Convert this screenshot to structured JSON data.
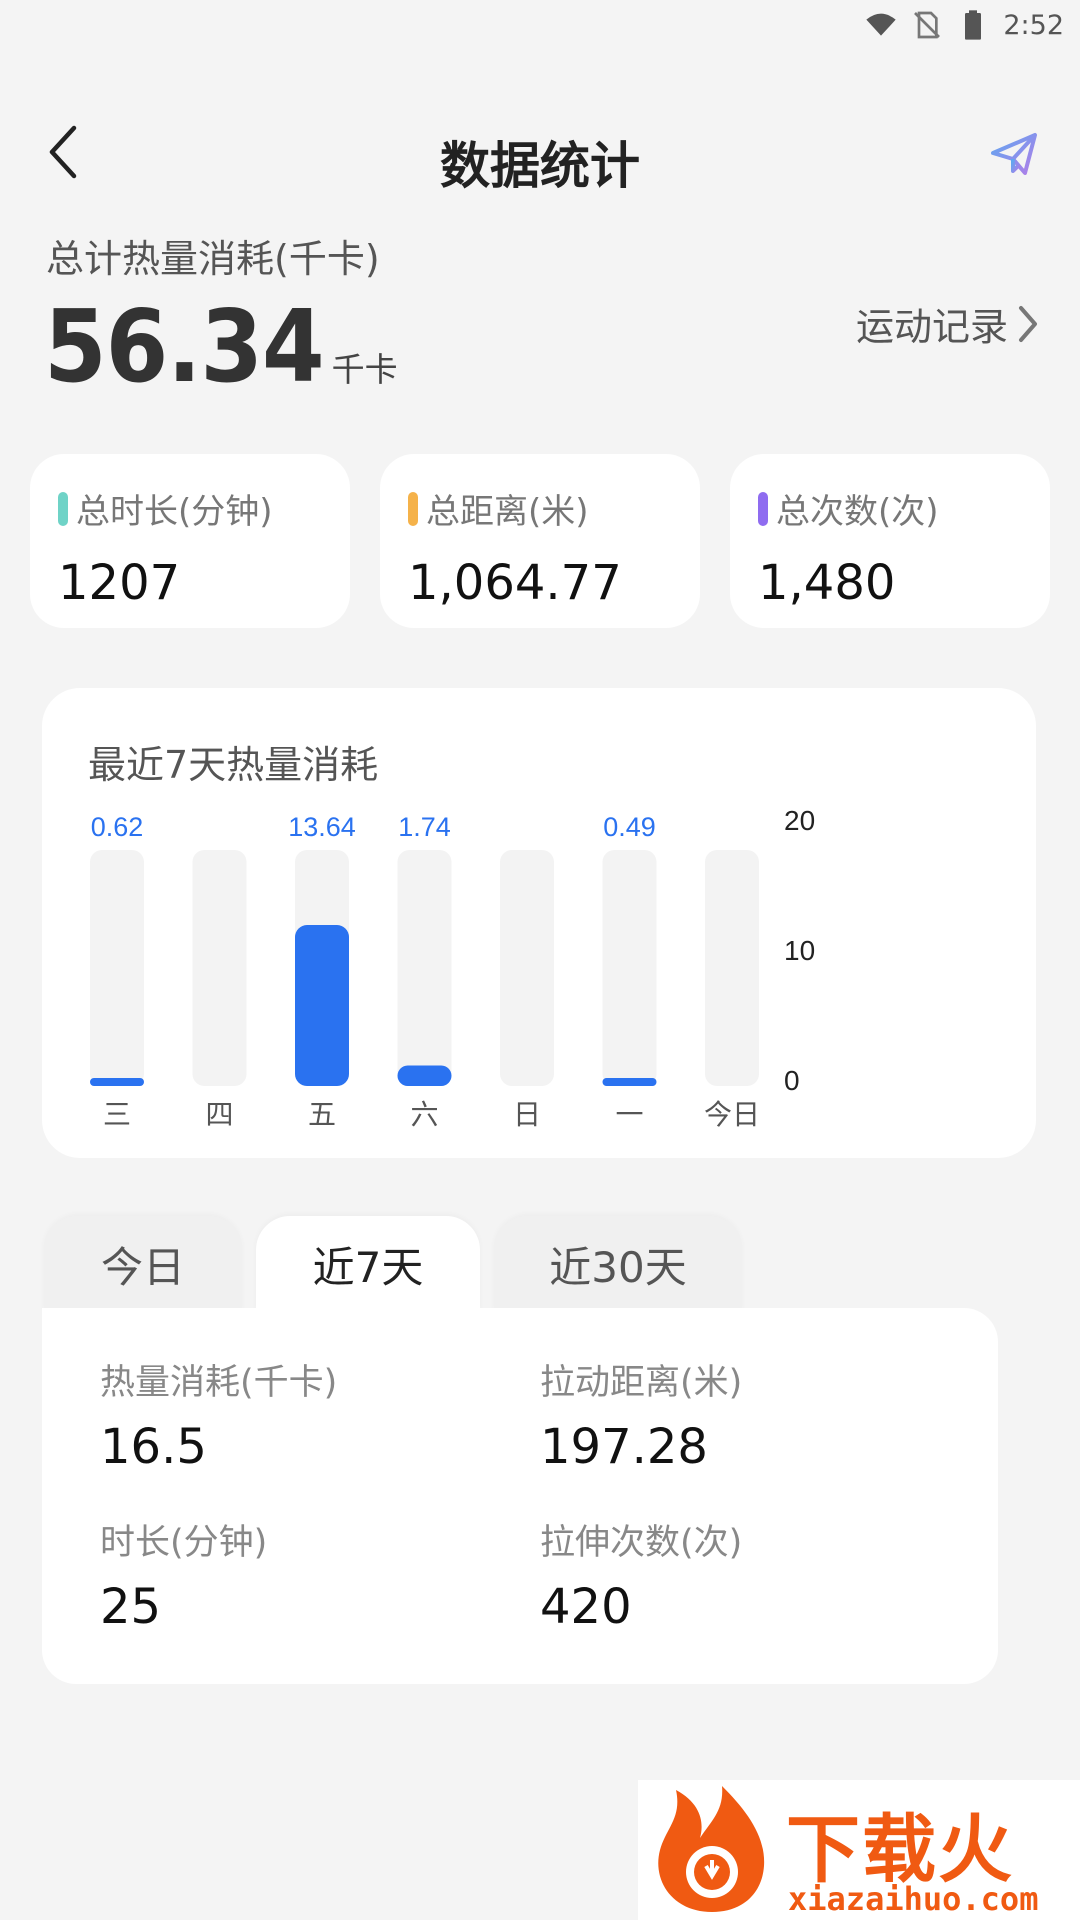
{
  "status_bar": {
    "time": "2:52"
  },
  "header": {
    "title": "数据统计"
  },
  "summary": {
    "label": "总计热量消耗(千卡)",
    "value": "56.34",
    "unit": "千卡",
    "record_link": "运动记录"
  },
  "stats": [
    {
      "label": "总时长(分钟)",
      "value": "1207",
      "color": "#6fd3c7"
    },
    {
      "label": "总距离(米)",
      "value": "1,064.77",
      "color": "#f5b24a"
    },
    {
      "label": "总次数(次)",
      "value": "1,480",
      "color": "#8f6cf0"
    }
  ],
  "chart_data": {
    "type": "bar",
    "title": "最近7天热量消耗",
    "categories": [
      "三",
      "四",
      "五",
      "六",
      "日",
      "一",
      "今日"
    ],
    "values": [
      0.62,
      0,
      13.64,
      1.74,
      0,
      0.49,
      0
    ],
    "value_labels": [
      "0.62",
      "",
      "13.64",
      "1.74",
      "",
      "0.49",
      ""
    ],
    "y_ticks": [
      "20",
      "10",
      "0"
    ],
    "ylim": [
      0,
      20
    ],
    "bar_color": "#2a72f0",
    "track_color": "#f3f3f3",
    "label_color": "#2a72f0"
  },
  "tabs": [
    {
      "label": "今日",
      "active": false
    },
    {
      "label": "近7天",
      "active": true
    },
    {
      "label": "近30天",
      "active": false
    }
  ],
  "details": [
    {
      "label": "热量消耗(千卡)",
      "value": "16.5"
    },
    {
      "label": "拉动距离(米)",
      "value": "197.28"
    },
    {
      "label": "时长(分钟)",
      "value": "25"
    },
    {
      "label": "拉伸次数(次)",
      "value": "420"
    }
  ],
  "watermark": {
    "text": "下载火",
    "url": "xiazaihuo.com"
  }
}
